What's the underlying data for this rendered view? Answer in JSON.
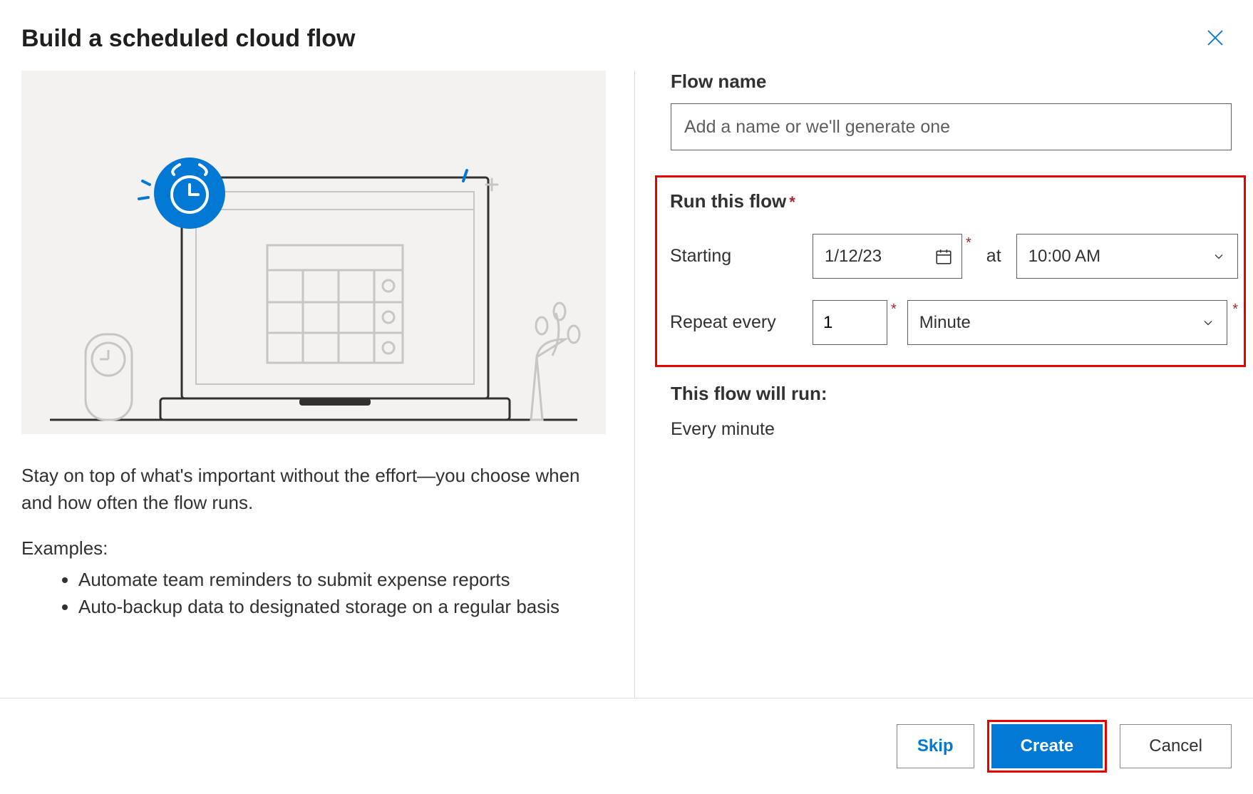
{
  "title": "Build a scheduled cloud flow",
  "left": {
    "description": "Stay on top of what's important without the effort—you choose when and how often the flow runs.",
    "examples_label": "Examples:",
    "examples": [
      "Automate team reminders to submit expense reports",
      "Auto-backup data to designated storage on a regular basis"
    ]
  },
  "form": {
    "flow_name_label": "Flow name",
    "flow_name_placeholder": "Add a name or we'll generate one",
    "flow_name_value": "",
    "run_label": "Run this flow",
    "starting_label": "Starting",
    "starting_date": "1/12/23",
    "at_label": "at",
    "starting_time": "10:00 AM",
    "repeat_label": "Repeat every",
    "repeat_interval": "1",
    "repeat_unit": "Minute",
    "summary_label": "This flow will run:",
    "summary_text": "Every minute"
  },
  "buttons": {
    "skip": "Skip",
    "create": "Create",
    "cancel": "Cancel"
  },
  "colors": {
    "primary": "#0078d4",
    "highlight": "#e60000"
  }
}
